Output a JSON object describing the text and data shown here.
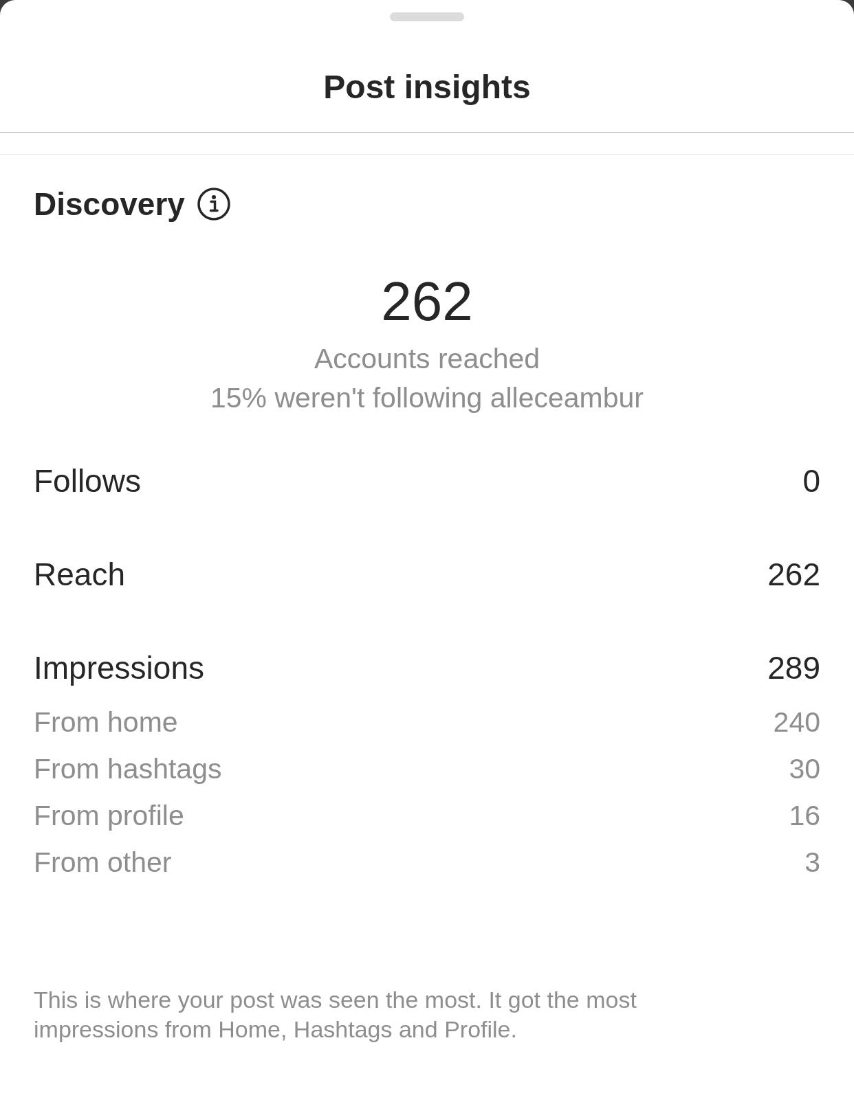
{
  "sheet": {
    "title": "Post insights"
  },
  "section": {
    "title": "Discovery"
  },
  "summary": {
    "value": "262",
    "label": "Accounts reached",
    "note": "15% weren't following alleceambur"
  },
  "metrics": [
    {
      "label": "Follows",
      "value": "0"
    },
    {
      "label": "Reach",
      "value": "262"
    },
    {
      "label": "Impressions",
      "value": "289",
      "breakdown": [
        {
          "label": "From home",
          "value": "240"
        },
        {
          "label": "From hashtags",
          "value": "30"
        },
        {
          "label": "From profile",
          "value": "16"
        },
        {
          "label": "From other",
          "value": "3"
        }
      ]
    }
  ],
  "footer": "This is where your post was seen the most. It got the most impressions from Home, Hashtags and Profile."
}
